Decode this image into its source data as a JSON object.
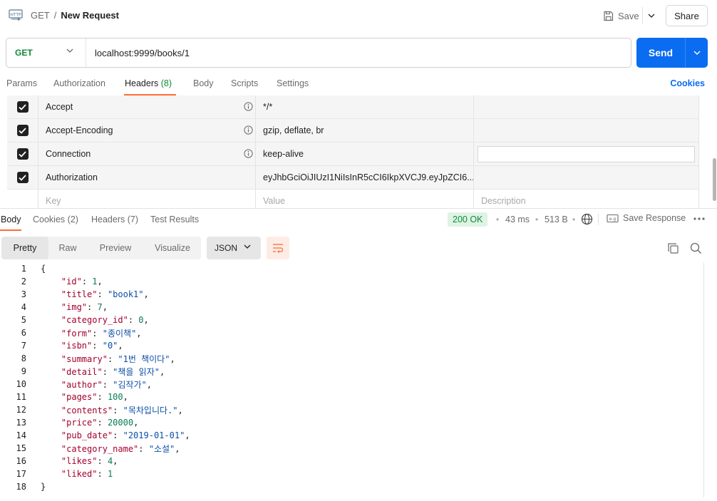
{
  "topbar": {
    "method_crumb": "GET",
    "separator": "/",
    "request_name": "New Request",
    "save_label": "Save",
    "share_label": "Share"
  },
  "request": {
    "method": "GET",
    "url": "localhost:9999/books/1",
    "send_label": "Send"
  },
  "request_tabs": [
    {
      "label": "Params"
    },
    {
      "label": "Authorization"
    },
    {
      "label": "Headers",
      "count": "(8)"
    },
    {
      "label": "Body"
    },
    {
      "label": "Scripts"
    },
    {
      "label": "Settings"
    }
  ],
  "cookies_label": "Cookies",
  "headers": {
    "rows": [
      {
        "key": "Accept",
        "value": "*/*",
        "description": ""
      },
      {
        "key": "Accept-Encoding",
        "value": "gzip, deflate, br",
        "description": ""
      },
      {
        "key": "Connection",
        "value": "keep-alive",
        "description": ""
      },
      {
        "key": "Authorization",
        "value": "eyJhbGciOiJIUzI1NiIsInR5cCI6IkpXVCJ9.eyJpZCI6...",
        "description": ""
      }
    ],
    "placeholder": {
      "key": "Key",
      "value": "Value",
      "description": "Description"
    }
  },
  "response": {
    "tabs": [
      {
        "label": "Body"
      },
      {
        "label": "Cookies",
        "count": "(2)"
      },
      {
        "label": "Headers",
        "count": "(7)"
      },
      {
        "label": "Test Results"
      }
    ],
    "status": "200 OK",
    "time": "43 ms",
    "size": "513 B",
    "save_response_label": "Save Response",
    "views": [
      "Pretty",
      "Raw",
      "Preview",
      "Visualize"
    ],
    "format": "JSON",
    "body_lines": [
      "{",
      "\"id\": 1,",
      "\"title\": \"book1\",",
      "\"img\": 7,",
      "\"category_id\": 0,",
      "\"form\": \"종이책\",",
      "\"isbn\": \"0\",",
      "\"summary\": \"1번 책이다\",",
      "\"detail\": \"책을 읽자\",",
      "\"author\": \"김작가\",",
      "\"pages\": 100,",
      "\"contents\": \"목차입니다.\",",
      "\"price\": 20000,",
      "\"pub_date\": \"2019-01-01\",",
      "\"category_name\": \"소설\",",
      "\"likes\": 4,",
      "\"liked\": 1",
      "}"
    ]
  },
  "colors": {
    "accent_blue": "#0a6cf1",
    "method_green": "#0f8a3a",
    "tab_orange": "#ff6c37",
    "json_key": "#a3002b",
    "json_string": "#0b4fa6",
    "json_number": "#0b7a55"
  },
  "icons": [
    "http-icon",
    "save-icon",
    "chevron-down-icon",
    "info-icon",
    "check-icon",
    "globe-icon",
    "save-response-icon",
    "more-icon",
    "wrap-icon",
    "copy-icon",
    "search-icon"
  ]
}
